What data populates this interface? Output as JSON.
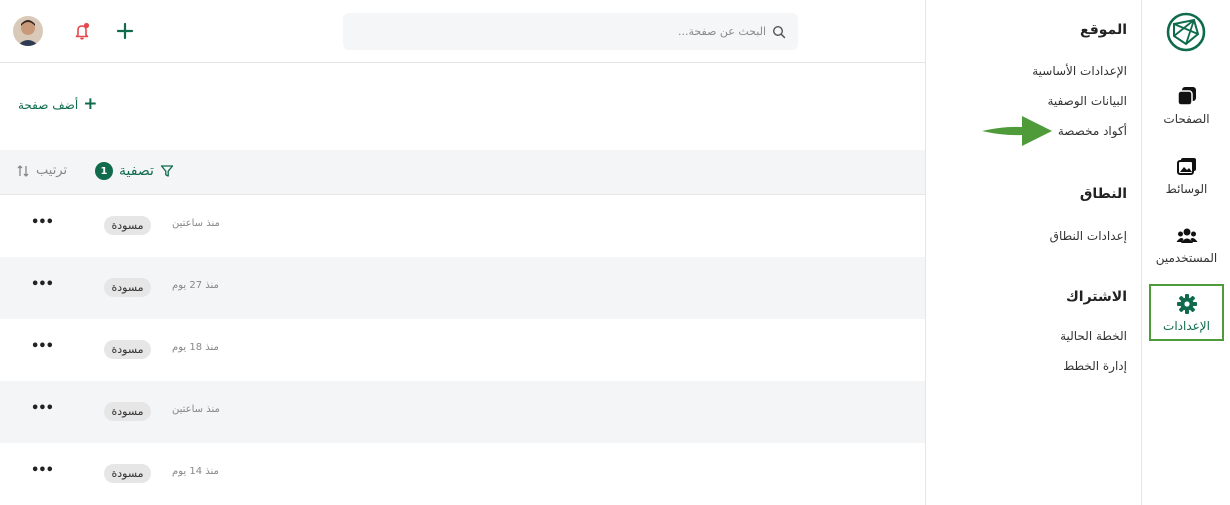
{
  "sidebar": {
    "items": [
      {
        "label": "الصفحات",
        "icon": "pages-icon"
      },
      {
        "label": "الوسائط",
        "icon": "media-icon"
      },
      {
        "label": "المستخدمين",
        "icon": "users-icon"
      },
      {
        "label": "الإعدادات",
        "icon": "gear-icon",
        "active": true
      }
    ]
  },
  "settings_menu": {
    "site": {
      "title": "الموقع",
      "links": [
        "الإعدادات الأساسية",
        "البيانات الوصفية",
        "أكواد مخصصة"
      ]
    },
    "domain": {
      "title": "النطاق",
      "links": [
        "إعدادات النطاق"
      ]
    },
    "subscription": {
      "title": "الاشتراك",
      "links": [
        "الخطة الحالية",
        "إدارة الخطط"
      ]
    }
  },
  "header": {
    "search_placeholder": "البحث عن صفحة..."
  },
  "pages": {
    "add_label": "أضف صفحة",
    "sort_label": "ترتيب",
    "filter_label": "تصفية",
    "filter_count": "1",
    "rows": [
      {
        "status": "مسودة",
        "time": "منذ ساعتين"
      },
      {
        "status": "مسودة",
        "time": "منذ 27 يوم"
      },
      {
        "status": "مسودة",
        "time": "منذ 18 يوم"
      },
      {
        "status": "مسودة",
        "time": "منذ ساعتين"
      },
      {
        "status": "مسودة",
        "time": "منذ 14 يوم"
      }
    ],
    "more_glyph": "•••"
  },
  "colors": {
    "brand": "#0f6b4b",
    "accent_border": "#4f9b3a",
    "arrow": "#4f9b3a",
    "notify": "#e5484d"
  }
}
